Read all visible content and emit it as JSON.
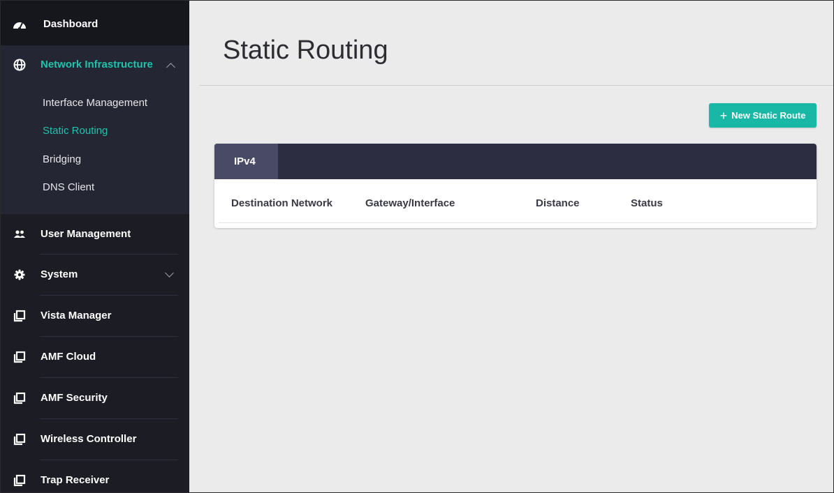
{
  "sidebar": {
    "dashboard": {
      "label": "Dashboard",
      "icon": "speedometer-icon"
    },
    "network_infrastructure": {
      "label": "Network Infrastructure",
      "icon": "globe-icon",
      "expanded": true,
      "items": [
        {
          "label": "Interface Management",
          "active": false
        },
        {
          "label": "Static Routing",
          "active": true
        },
        {
          "label": "Bridging",
          "active": false
        },
        {
          "label": "DNS Client",
          "active": false
        }
      ]
    },
    "user_management": {
      "label": "User Management",
      "icon": "users-icon"
    },
    "system": {
      "label": "System",
      "icon": "gear-icon",
      "expanded": false
    },
    "vista_manager": {
      "label": "Vista Manager",
      "icon": "external-window-icon"
    },
    "amf_cloud": {
      "label": "AMF Cloud",
      "icon": "external-window-icon"
    },
    "amf_security": {
      "label": "AMF Security",
      "icon": "external-window-icon"
    },
    "wireless_controller": {
      "label": "Wireless Controller",
      "icon": "external-window-icon"
    },
    "trap_receiver": {
      "label": "Trap Receiver",
      "icon": "external-window-icon"
    }
  },
  "main": {
    "title": "Static Routing",
    "new_button_label": "New Static Route",
    "tabs": [
      {
        "label": "IPv4",
        "active": true
      }
    ],
    "columns": [
      "Destination Network",
      "Gateway/Interface",
      "Distance",
      "Status"
    ],
    "rows": []
  },
  "colors": {
    "accent": "#1fc3ac",
    "button": "#19b8a6",
    "sidebar_bg": "#1c1c24",
    "tabbar_bg": "#2c2d40",
    "tab_active_bg": "#494a66"
  }
}
